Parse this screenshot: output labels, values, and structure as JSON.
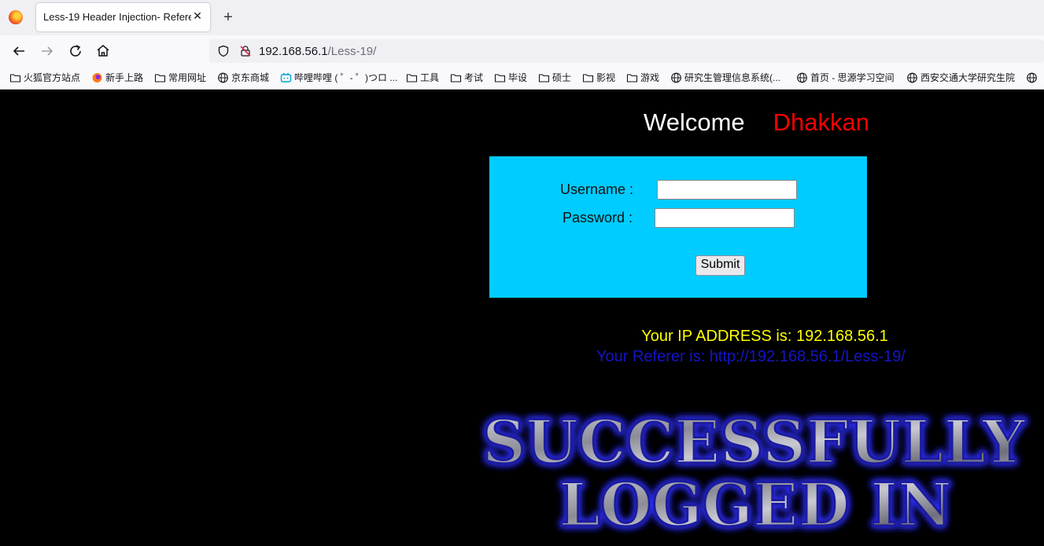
{
  "browser": {
    "tab_title": "Less-19 Header Injection- Referer",
    "url_host": "192.168.56.1",
    "url_path": "/Less-19/"
  },
  "bookmarks": [
    {
      "label": "火狐官方站点",
      "icon": "folder-icon"
    },
    {
      "label": "新手上路",
      "icon": "firefox-icon"
    },
    {
      "label": "常用网址",
      "icon": "folder-icon"
    },
    {
      "label": "京东商城",
      "icon": "globe-icon"
    },
    {
      "label": "哔哩哔哩 ( ゜- ゜)つロ ...",
      "icon": "bilibili-icon"
    },
    {
      "label": "工具",
      "icon": "folder-icon"
    },
    {
      "label": "考试",
      "icon": "folder-icon"
    },
    {
      "label": "毕设",
      "icon": "folder-icon"
    },
    {
      "label": "硕士",
      "icon": "folder-icon"
    },
    {
      "label": "影视",
      "icon": "folder-icon"
    },
    {
      "label": "游戏",
      "icon": "folder-icon"
    },
    {
      "label": "研究生管理信息系统(...",
      "icon": "globe-icon"
    },
    {
      "label": "首页 - 思源学习空间",
      "icon": "globe-icon"
    },
    {
      "label": "西安交通大学研究生院",
      "icon": "globe-icon"
    },
    {
      "label": "",
      "icon": "globe-icon"
    }
  ],
  "page": {
    "welcome": "Welcome",
    "user_name": "Dhakkan",
    "username_label": "Username :",
    "password_label": "Password :",
    "username_value": "",
    "password_value": "",
    "submit_label": "Submit",
    "ip_text": "Your IP ADDRESS is: 192.168.56.1",
    "referer_text": "Your Referer is: http://192.168.56.1/Less-19/",
    "success_line1": "SUCCESSFULLY",
    "success_line2": "LOGGED IN"
  },
  "colors": {
    "login_box": "#00ccff",
    "name": "#ff0000",
    "ip": "#ffff00",
    "referer": "#1414c8"
  }
}
